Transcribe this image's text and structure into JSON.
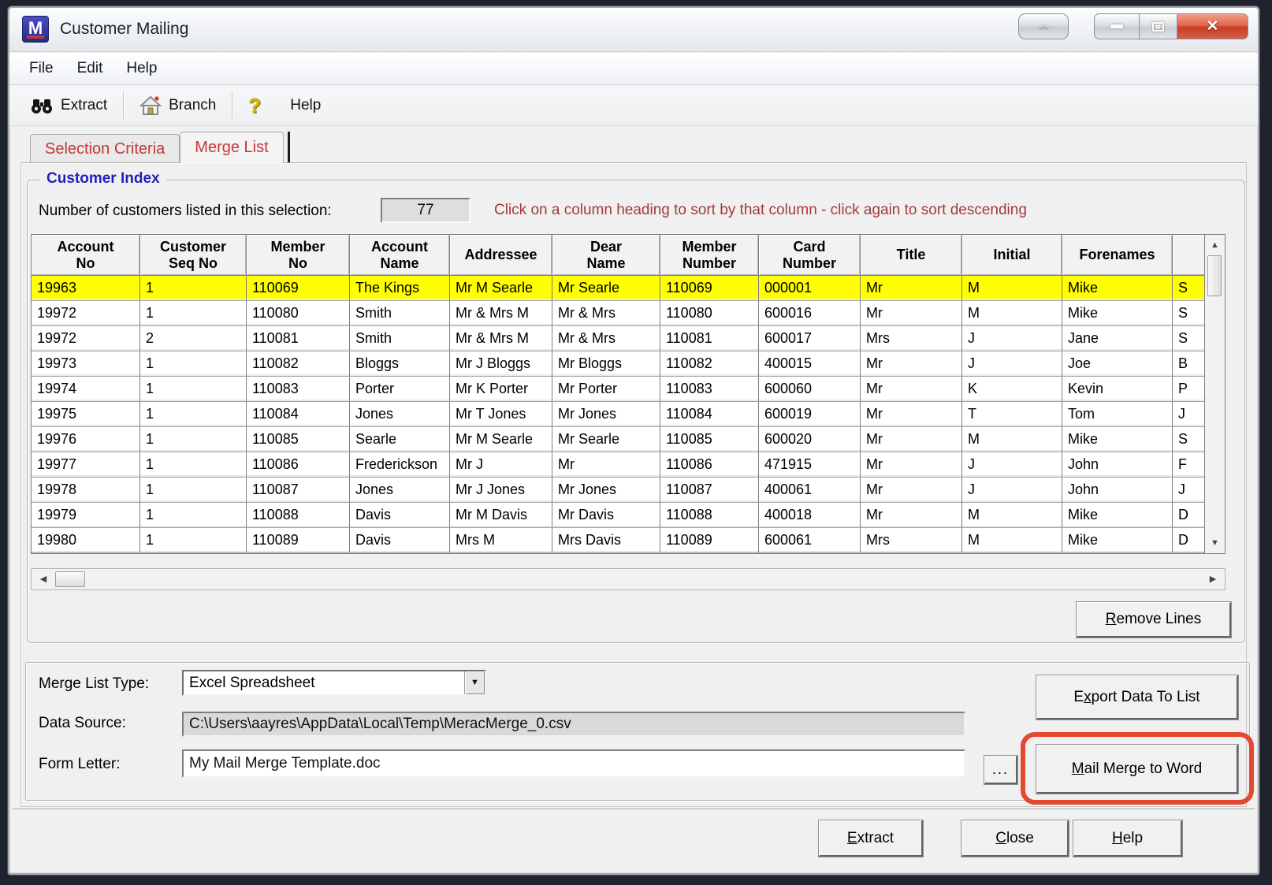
{
  "window": {
    "title": "Customer Mailing",
    "app_icon_letter": "M"
  },
  "menu": {
    "items": [
      "File",
      "Edit",
      "Help"
    ]
  },
  "toolbar": {
    "extract_label": "Extract",
    "branch_label": "Branch",
    "help_label": "Help",
    "help_icon_glyph": "?"
  },
  "tabs": [
    {
      "label": "Selection Criteria",
      "active": false
    },
    {
      "label": "Merge List",
      "active": true
    }
  ],
  "customer_index": {
    "legend": "Customer Index",
    "count_label": "Number of customers listed in this selection:",
    "count_value": "77",
    "sort_hint": "Click on a column heading to sort by that column - click again to sort descending",
    "table": {
      "columns": [
        "Account\nNo",
        "Customer\nSeq No",
        "Member\nNo",
        "Account\nName",
        "Addressee",
        "Dear\nName",
        "Member\nNumber",
        "Card\nNumber",
        "Title",
        "Initial",
        "Forenames",
        ""
      ],
      "rows": [
        {
          "highlighted": true,
          "cells": [
            "19963",
            "1",
            "110069",
            "The Kings",
            "Mr M Searle",
            "Mr Searle",
            "110069",
            "000001",
            "Mr",
            "M",
            "Mike",
            "S"
          ]
        },
        {
          "highlighted": false,
          "cells": [
            "19972",
            "1",
            "110080",
            "Smith",
            "Mr & Mrs M",
            "Mr & Mrs",
            "110080",
            "600016",
            "Mr",
            "M",
            "Mike",
            "S"
          ]
        },
        {
          "highlighted": false,
          "cells": [
            "19972",
            "2",
            "110081",
            "Smith",
            "Mr & Mrs M",
            "Mr & Mrs",
            "110081",
            "600017",
            "Mrs",
            "J",
            "Jane",
            "S"
          ]
        },
        {
          "highlighted": false,
          "cells": [
            "19973",
            "1",
            "110082",
            "Bloggs",
            "Mr J Bloggs",
            "Mr Bloggs",
            "110082",
            "400015",
            "Mr",
            "J",
            "Joe",
            "B"
          ]
        },
        {
          "highlighted": false,
          "cells": [
            "19974",
            "1",
            "110083",
            "Porter",
            "Mr K Porter",
            "Mr Porter",
            "110083",
            "600060",
            "Mr",
            "K",
            "Kevin",
            "P"
          ]
        },
        {
          "highlighted": false,
          "cells": [
            "19975",
            "1",
            "110084",
            "Jones",
            "Mr T Jones",
            "Mr Jones",
            "110084",
            "600019",
            "Mr",
            "T",
            "Tom",
            "J"
          ]
        },
        {
          "highlighted": false,
          "cells": [
            "19976",
            "1",
            "110085",
            "Searle",
            "Mr M Searle",
            "Mr Searle",
            "110085",
            "600020",
            "Mr",
            "M",
            "Mike",
            "S"
          ]
        },
        {
          "highlighted": false,
          "cells": [
            "19977",
            "1",
            "110086",
            "Frederickson",
            "Mr J",
            "Mr",
            "110086",
            "471915",
            "Mr",
            "J",
            "John",
            "F"
          ]
        },
        {
          "highlighted": false,
          "cells": [
            "19978",
            "1",
            "110087",
            "Jones",
            "Mr J Jones",
            "Mr Jones",
            "110087",
            "400061",
            "Mr",
            "J",
            "John",
            "J"
          ]
        },
        {
          "highlighted": false,
          "cells": [
            "19979",
            "1",
            "110088",
            "Davis",
            "Mr M Davis",
            "Mr Davis",
            "110088",
            "400018",
            "Mr",
            "M",
            "Mike",
            "D"
          ]
        },
        {
          "highlighted": false,
          "cells": [
            "19980",
            "1",
            "110089",
            "Davis",
            "Mrs M",
            "Mrs Davis",
            "110089",
            "600061",
            "Mrs",
            "M",
            "Mike",
            "D"
          ]
        }
      ]
    },
    "remove_lines": {
      "label": "Remove Lines",
      "accel": "R"
    }
  },
  "merge_form": {
    "merge_list_type_label": "Merge List Type:",
    "merge_list_type_value": "Excel Spreadsheet",
    "data_source_label": "Data Source:",
    "data_source_value": "C:\\Users\\aayres\\AppData\\Local\\Temp\\MeracMerge_0.csv",
    "form_letter_label": "Form Letter:",
    "form_letter_value": "My Mail Merge Template.doc",
    "browse_label": "...",
    "export_button": {
      "label": "Export Data To List",
      "accel": "x"
    },
    "mail_merge_button": {
      "label": "Mail Merge to Word",
      "accel": "M"
    }
  },
  "footer": {
    "extract_button": {
      "label": "Extract",
      "accel": "E"
    },
    "close_button": {
      "label": "Close",
      "accel": "C"
    },
    "help_button": {
      "label": "Help",
      "accel": "H"
    }
  },
  "colors": {
    "highlight_row": "#ffff00",
    "annotation_ring": "#e2492e",
    "tab_text": "#c53636",
    "hint_text": "#a33a3a",
    "legend_text": "#2222bb",
    "close_button": "#c63d22"
  }
}
